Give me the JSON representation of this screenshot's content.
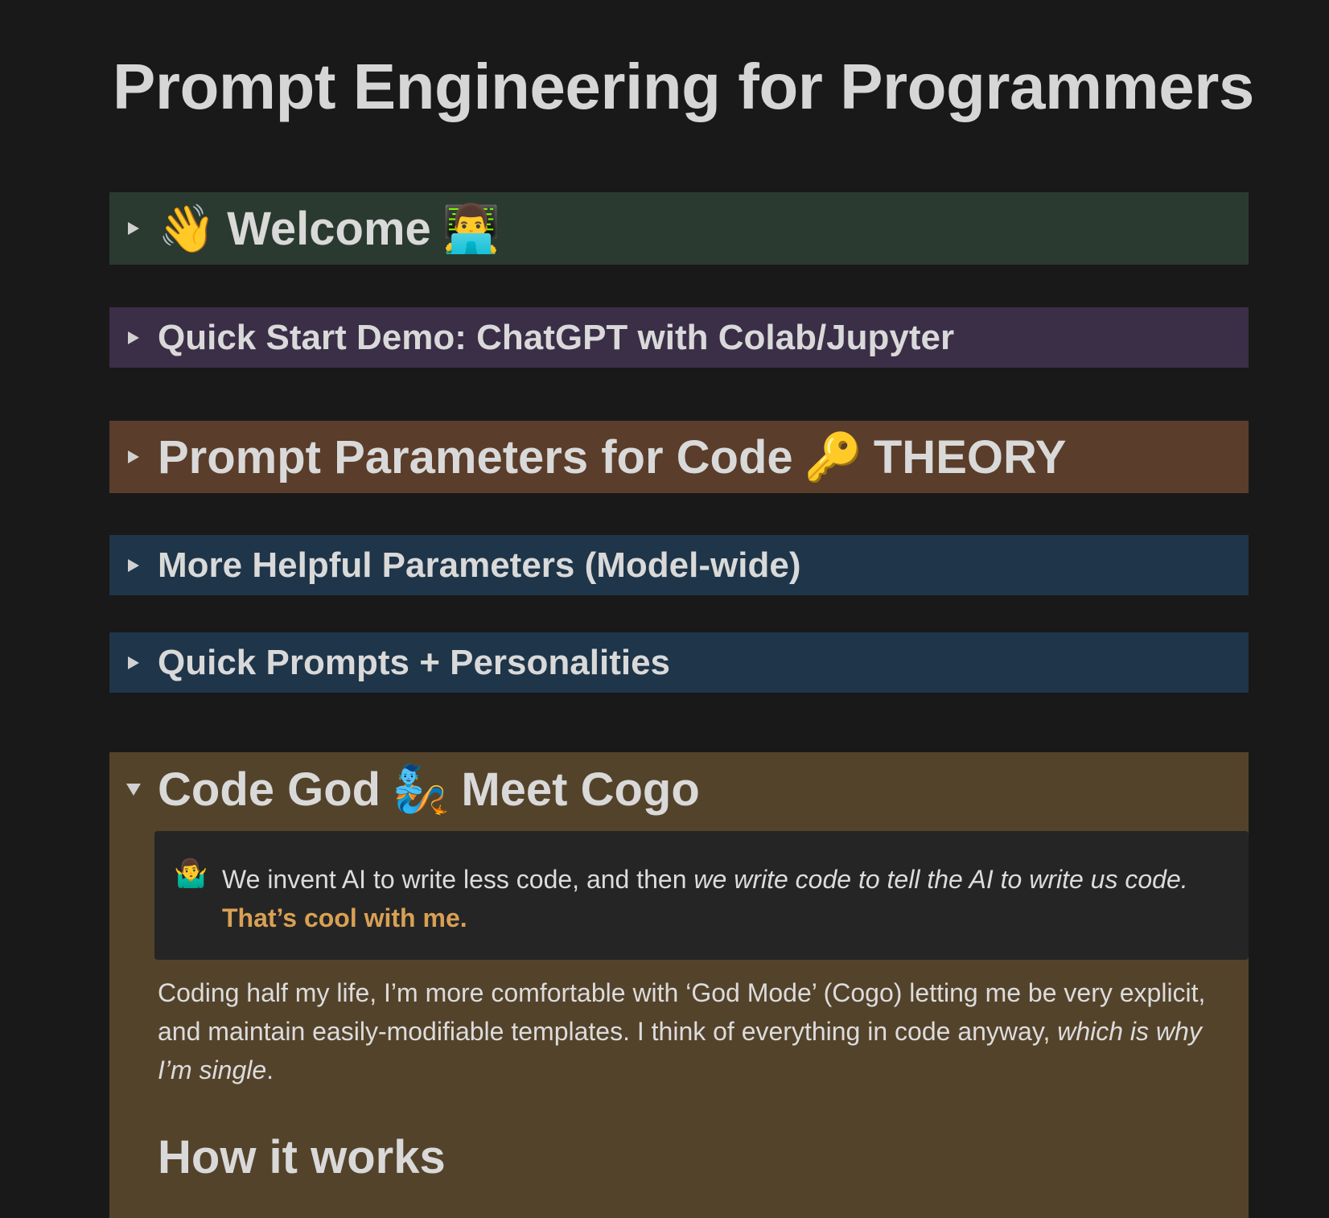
{
  "page": {
    "title": "Prompt Engineering for Programmers"
  },
  "toggles": [
    {
      "key": "welcome",
      "emoji_before": "👋",
      "label": "Welcome",
      "emoji_after": "👨‍💻",
      "color": "#2b3a30",
      "expanded": false
    },
    {
      "key": "quick_start",
      "label": "Quick Start Demo: ChatGPT with Colab/Jupyter",
      "color": "#3b2e47",
      "expanded": false
    },
    {
      "key": "params",
      "label": "Prompt Parameters for Code",
      "emoji_after": "🔑",
      "label_after": "THEORY",
      "color": "#5a3d2a",
      "expanded": false
    },
    {
      "key": "more_params",
      "label": "More Helpful Parameters (Model-wide)",
      "color": "#1f3549",
      "expanded": false
    },
    {
      "key": "quick_prompts",
      "label": "Quick Prompts + Personalities",
      "color": "#1f3549",
      "expanded": false
    },
    {
      "key": "cogo",
      "label": "Code God",
      "emoji_after": "🧞",
      "label_after": "Meet Cogo",
      "color": "#54432b",
      "expanded": true
    }
  ],
  "cogo": {
    "callout": {
      "icon": "🤷‍♂️",
      "text_plain": "We invent AI to write less code, and then ",
      "text_italic": "we write code to tell the AI to write us code.",
      "text_accent": "That’s cool with me."
    },
    "paragraph": {
      "text_plain": "Coding half my life, I’m more comfortable with ‘God Mode’ (Cogo) letting me be very explicit, and maintain easily-modifiable templates. I think of everything in code anyway, ",
      "text_italic": "which is why I’m single",
      "text_end": "."
    },
    "subheading": "How it works"
  },
  "colors": {
    "background": "#191919",
    "accent": "#d9a054"
  }
}
